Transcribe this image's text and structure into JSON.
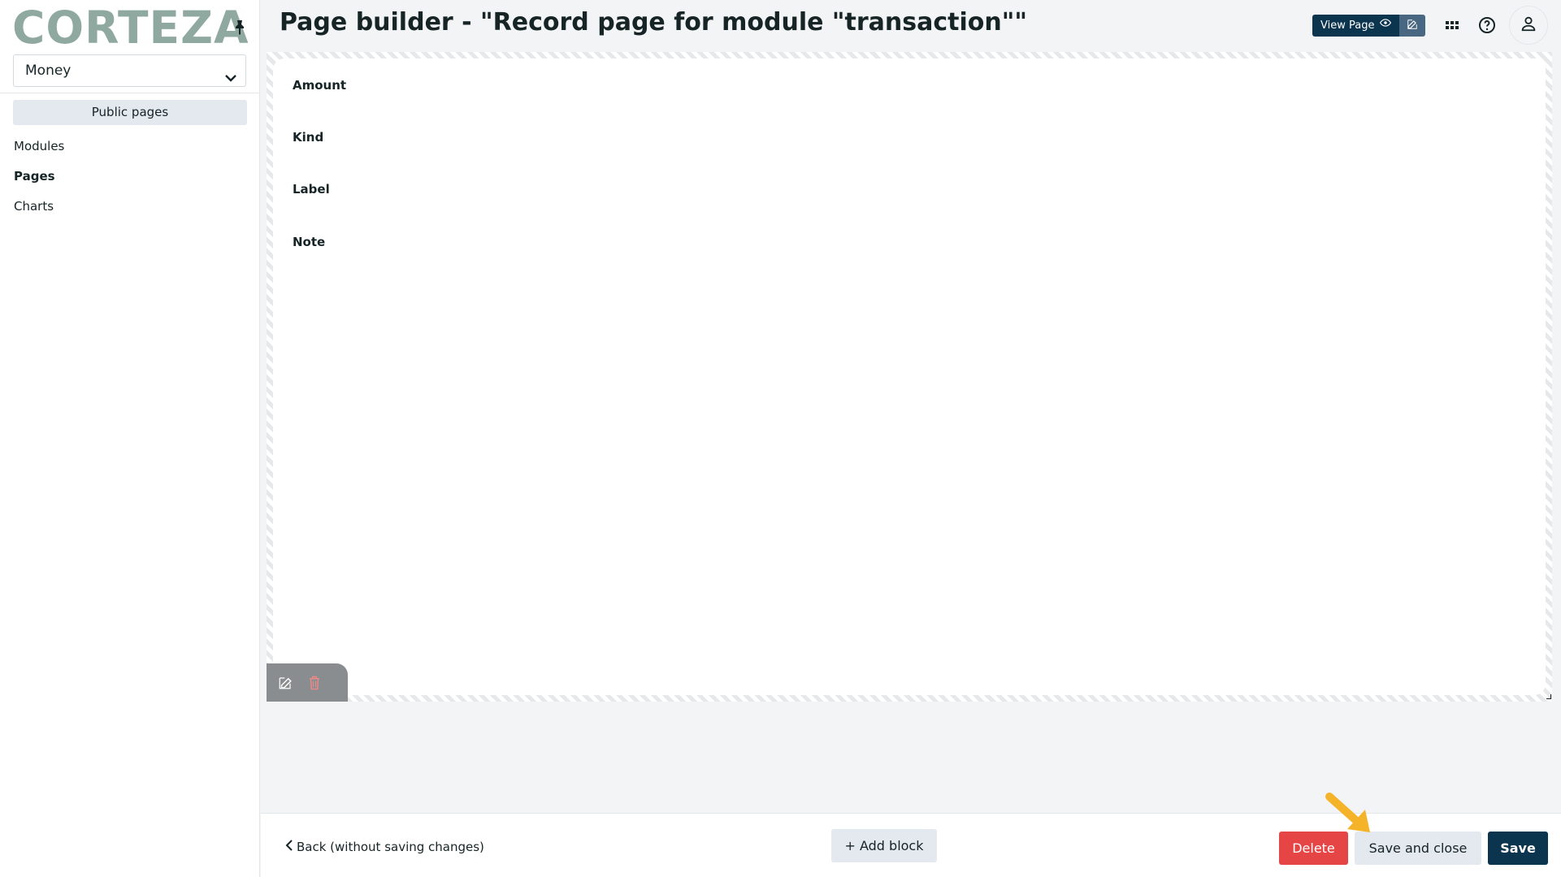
{
  "app": {
    "logo": "CORTEZA"
  },
  "sidebar": {
    "namespace": "Money",
    "public_pages": "Public pages",
    "items": [
      {
        "label": "Modules",
        "active": false
      },
      {
        "label": "Pages",
        "active": true
      },
      {
        "label": "Charts",
        "active": false
      }
    ]
  },
  "header": {
    "title": "Page builder - \"Record page for module \"transaction\"\"",
    "view_page": "View Page"
  },
  "block": {
    "fields": [
      "Amount",
      "Kind",
      "Label",
      "Note"
    ]
  },
  "footer": {
    "back": "Back (without saving changes)",
    "add_block": "+ Add block",
    "delete": "Delete",
    "save_and_close": "Save and close",
    "save": "Save"
  },
  "colors": {
    "primary": "#0b344e",
    "danger": "#e54545",
    "logo": "#8fa9a1",
    "hint_arrow": "#f5b32a"
  },
  "icons": [
    "pin-icon",
    "chevron-down-icon",
    "eye-icon",
    "edit-icon",
    "apps-grid-icon",
    "help-icon",
    "user-icon",
    "trash-icon",
    "chevron-left-icon"
  ]
}
